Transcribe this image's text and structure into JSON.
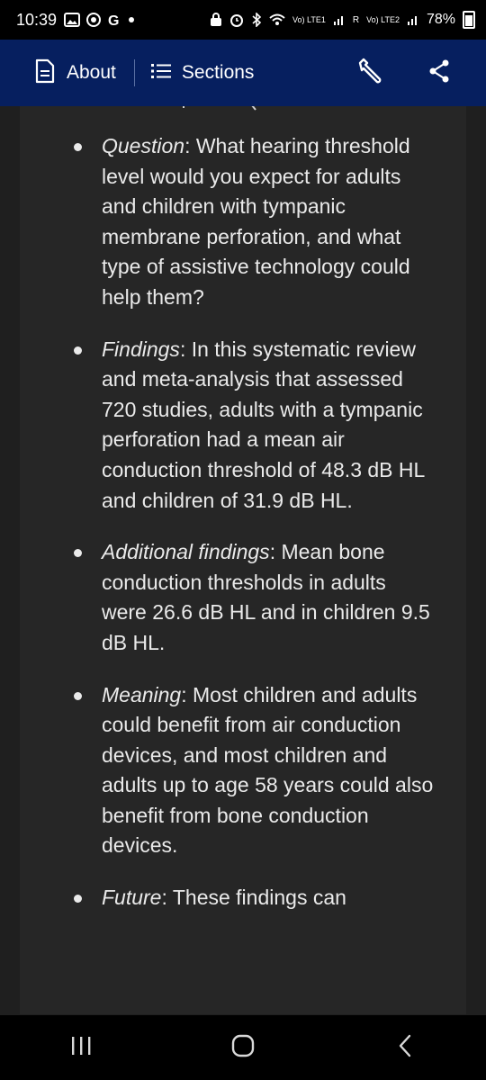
{
  "status_bar": {
    "time": "10:39",
    "battery": "78%",
    "network_labels": [
      "Vo) LTE1",
      "R",
      "Vo) LTE2"
    ]
  },
  "appbar": {
    "about_label": "About",
    "sections_label": "Sections"
  },
  "article": {
    "bullets": [
      {
        "term": "Question",
        "text": ": What hearing threshold level would you expect for adults and children with tympanic membrane perforation, and what type of assistive technology could help them?"
      },
      {
        "term": "Findings",
        "text": ": In this systematic review and meta-analysis that assessed 720 studies, adults with a tympanic perforation had a mean air conduction threshold of 48.3 dB HL and children of 31.9 dB HL."
      },
      {
        "term": "Additional findings",
        "text": ": Mean bone conduction thresholds in adults were 26.6 dB HL and in children 9.5 dB HL."
      },
      {
        "term": "Meaning",
        "text": ": Most children and adults could benefit from air conduction devices, and most children and adults up to age 58 years could also benefit from bone conduction devices."
      },
      {
        "term": "Future",
        "text": ": These findings can"
      }
    ]
  },
  "icons": {
    "about": "document-icon",
    "sections": "list-icon",
    "tools": "wrench-icon",
    "share": "share-icon",
    "recents": "recents-icon",
    "home": "home-icon",
    "back": "back-icon"
  }
}
